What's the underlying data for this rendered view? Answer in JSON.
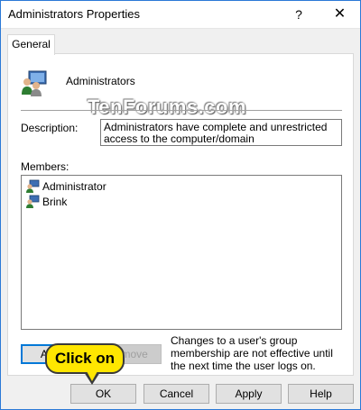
{
  "window": {
    "title": "Administrators Properties",
    "help_glyph": "?",
    "close_glyph": "✕"
  },
  "tabs": [
    {
      "label": "General",
      "selected": true
    }
  ],
  "group": {
    "name": "Administrators",
    "icon": "group-users-icon"
  },
  "watermark": "TenForums.com",
  "description": {
    "label": "Description:",
    "value": "Administrators have complete and unrestricted access to the computer/domain"
  },
  "members": {
    "label": "Members:",
    "items": [
      {
        "name": "Administrator",
        "icon": "user-icon"
      },
      {
        "name": "Brink",
        "icon": "user-icon"
      }
    ]
  },
  "buttons": {
    "add": "Add...",
    "remove": "Remove",
    "ok": "OK",
    "cancel": "Cancel",
    "apply": "Apply",
    "help": "Help"
  },
  "note": "Changes to a user's group membership are not effective until the next time the user logs on.",
  "callout": "Click on",
  "colors": {
    "accent": "#0078d7",
    "callout": "#ffe600"
  }
}
